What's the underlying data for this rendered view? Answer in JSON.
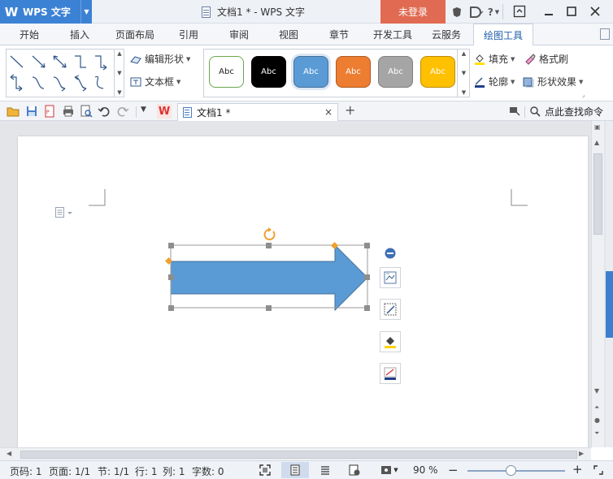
{
  "titlebar": {
    "app_logo": "W",
    "app_name": "WPS 文字",
    "document_title": "文档1 * - WPS 文字",
    "login_label": "未登录",
    "help_label": "?"
  },
  "menu_tabs": [
    {
      "label": "开始"
    },
    {
      "label": "插入"
    },
    {
      "label": "页面布局"
    },
    {
      "label": "引用"
    },
    {
      "label": "审阅"
    },
    {
      "label": "视图"
    },
    {
      "label": "章节"
    },
    {
      "label": "开发工具"
    },
    {
      "label": "云服务"
    },
    {
      "label": "绘图工具",
      "active": true
    }
  ],
  "ribbon": {
    "edit_shape_label": "编辑形状",
    "text_box_label": "文本框",
    "shape_styles": [
      {
        "label": "Abc",
        "fill": "#ffffff",
        "border": "#6aa84f",
        "text": "#222222"
      },
      {
        "label": "Abc",
        "fill": "#000000",
        "border": "#000000",
        "text": "#ffffff"
      },
      {
        "label": "Abc",
        "fill": "#5b9bd5",
        "border": "#41719c",
        "text": "#ffffff"
      },
      {
        "label": "Abc",
        "fill": "#ed7d31",
        "border": "#ae5a21",
        "text": "#ffffff"
      },
      {
        "label": "Abc",
        "fill": "#a5a5a5",
        "border": "#7f7f7f",
        "text": "#ffffff"
      },
      {
        "label": "Abc",
        "fill": "#ffc000",
        "border": "#bc8c00",
        "text": "#ffffff"
      }
    ],
    "fill_label": "填充",
    "format_painter_label": "格式刷",
    "outline_label": "轮廓",
    "shape_effects_label": "形状效果"
  },
  "toolbar": {
    "doc_tab_label": "文档1 *",
    "close_glyph": "×",
    "new_tab_glyph": "+",
    "find_command_label": "点此查找命令"
  },
  "shape": {
    "type": "right-arrow",
    "fill": "#5b9bd5",
    "stroke": "#41719c"
  },
  "status_bar": {
    "page_no": "页码: 1",
    "pages": "页面: 1/1",
    "section": "节: 1/1",
    "row": "行: 1",
    "column": "列: 1",
    "word_count": "字数: 0",
    "zoom_level": "90 %",
    "zoom_minus": "−",
    "zoom_plus": "+"
  },
  "colors": {
    "accent_blue": "#3c82d4",
    "login_red": "#e06b52",
    "shape_blue": "#5b9bd5",
    "handle_gray": "#8e8e8e",
    "rotate_orange": "#f0a030"
  }
}
